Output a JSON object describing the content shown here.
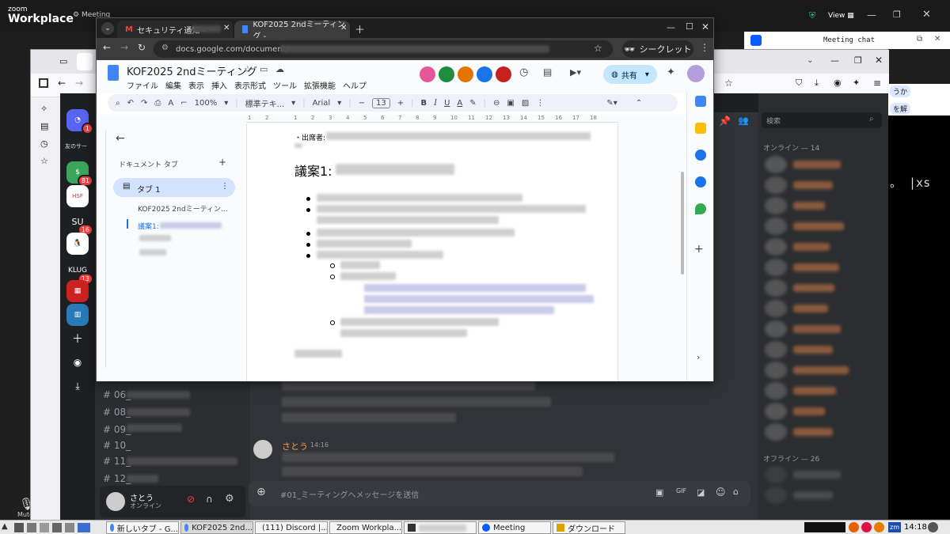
{
  "zoom": {
    "brand_small": "zoom",
    "brand_big": "Workplace",
    "meeting_label": "Meeting",
    "view_label": "View",
    "meeting_chat_title": "Meeting chat",
    "chat_snippet_1": "うか",
    "chat_snippet_2": "を解",
    "mute_label": "Mute",
    "right_text": "。 |xs"
  },
  "discord": {
    "channel_list": [
      "06_",
      "08_",
      "09_",
      "10_",
      "11_",
      "12_"
    ],
    "server_badges": [
      "1",
      "81",
      "16",
      "13"
    ],
    "server_labels": [
      "SU",
      "KLUG"
    ],
    "friends_server_label": "友のサー",
    "user": {
      "name": "さとう",
      "status": "オンライン"
    },
    "message": {
      "author": "さとう",
      "time": "14:16"
    },
    "composer_placeholder": "#01_ミーティングへメッセージを送信",
    "search_placeholder": "検索",
    "online_header": "オンライン — 14",
    "offline_header": "オフライン — 26"
  },
  "chrome": {
    "tabs": [
      {
        "title": "セキュリティ通知 -",
        "icon": "gmail-icon"
      },
      {
        "title": "KOF2025 2ndミーティング -",
        "icon": "docs-icon"
      }
    ],
    "url": "docs.google.com/document/",
    "incognito_label": "シークレット"
  },
  "docs": {
    "title": "KOF2025 2ndミーティング",
    "menu": [
      "ファイル",
      "編集",
      "表示",
      "挿入",
      "表示形式",
      "ツール",
      "拡張機能",
      "ヘルプ"
    ],
    "share_label": "共有",
    "zoom_level": "100%",
    "style": "標準テキ...",
    "font": "Arial",
    "font_size": "13",
    "sidebar_header": "ドキュメント タブ",
    "tab_name": "タブ 1",
    "outline": [
      "KOF2025 2ndミーティン...",
      "議案1:"
    ],
    "attendees_label": "・出席者:",
    "heading": "議案1:",
    "ruler_ticks": [
      "1",
      "2",
      "1",
      "2",
      "3",
      "4",
      "5",
      "6",
      "7",
      "8",
      "9",
      "10",
      "11",
      "12",
      "13",
      "14",
      "15",
      "16",
      "17",
      "18"
    ]
  },
  "taskbar": {
    "items": [
      {
        "label": "新しいタブ - G...",
        "color": "#4285f4"
      },
      {
        "label": "KOF2025 2nd...",
        "color": "#4285f4"
      },
      {
        "label": "(111) Discord |...",
        "color": "#e66000"
      },
      {
        "label": "Zoom Workpla...",
        "color": "#0b5cff"
      },
      {
        "label": "",
        "color": "#333333"
      },
      {
        "label": "Meeting",
        "color": "#0b5cff"
      },
      {
        "label": "ダウンロード",
        "color": "#d9a400"
      }
    ],
    "clock": "14:18",
    "tray_zm": "zm"
  }
}
